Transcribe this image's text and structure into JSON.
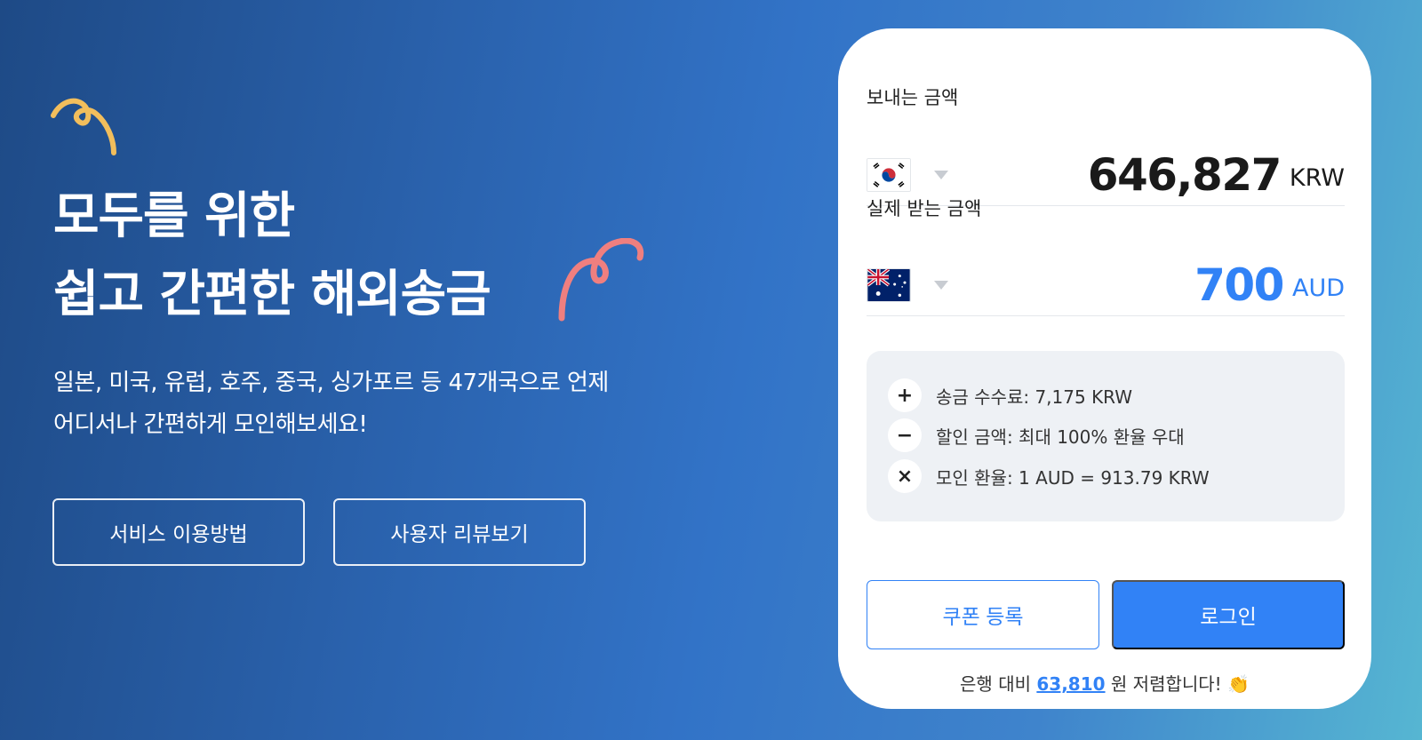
{
  "hero": {
    "title_line1": "모두를 위한",
    "title_line2": "쉽고 간편한 해외송금",
    "desc_line1": "일본, 미국, 유럽, 호주, 중국, 싱가포르 등 47개국으로 언제",
    "desc_line2": "어디서나 간편하게 모인해보세요!",
    "buttons": {
      "service_label": "서비스 이용방법",
      "review_label": "사용자 리뷰보기"
    }
  },
  "calculator": {
    "send": {
      "label": "보내는 금액",
      "amount": "646,827",
      "currency": "KRW",
      "flag_icon": "korea-flag-icon"
    },
    "receive": {
      "label": "실제 받는 금액",
      "amount": "700",
      "currency": "AUD",
      "flag_icon": "australia-flag-icon"
    },
    "details": [
      {
        "icon": "plus-icon",
        "symbol": "+",
        "text": "송금 수수료: 7,175 KRW"
      },
      {
        "icon": "minus-icon",
        "symbol": "−",
        "text": "할인 금액: 최대 100% 환율 우대"
      },
      {
        "icon": "times-icon",
        "symbol": "×",
        "text": "모인 환율: 1 AUD = 913.79 KRW"
      }
    ],
    "coupon_label": "쿠폰 등록",
    "login_label": "로그인",
    "savings": {
      "prefix": "은행 대비",
      "amount": "63,810",
      "suffix": "원 저렴합니다! 👏"
    }
  },
  "colors": {
    "accent": "#3182f6",
    "squiggle_yellow": "#f2be5c",
    "squiggle_pink": "#ef7f7f"
  }
}
